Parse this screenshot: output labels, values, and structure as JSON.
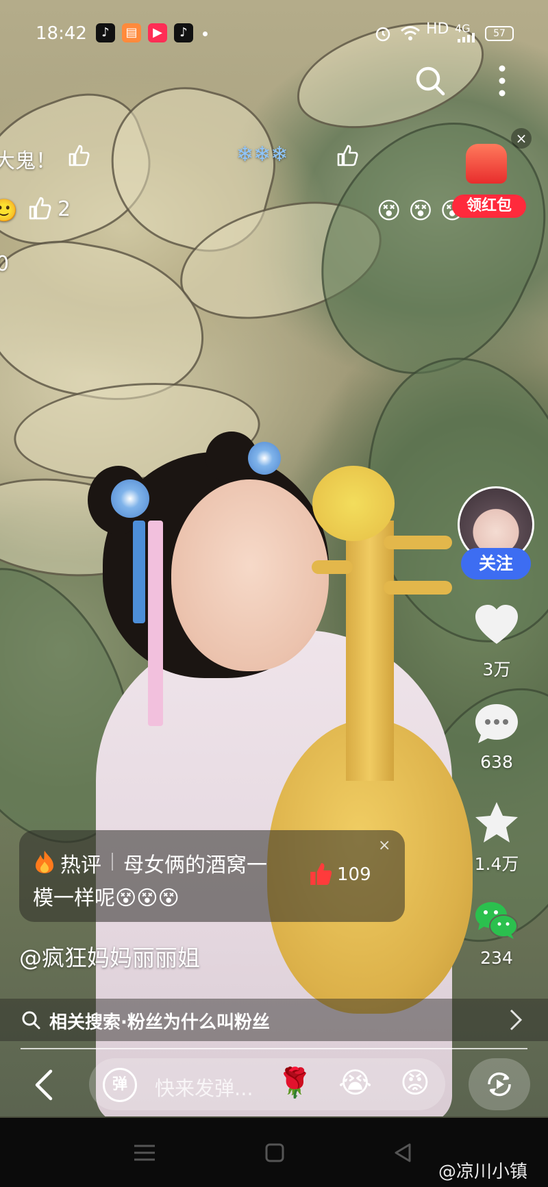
{
  "status_bar": {
    "time": "18:42",
    "network": "HD",
    "signal": "4G",
    "battery": "57",
    "app_icons": [
      "tiktok-icon",
      "reader-app-icon",
      "video-app-icon",
      "tiktok-lite-icon"
    ]
  },
  "danmaku": [
    {
      "text": "大鬼！"
    },
    {
      "text": "❄❄❄"
    },
    {
      "text": "2"
    },
    {
      "text": "0"
    }
  ],
  "emoji_reactions": [
    "😵",
    "😵",
    "😵"
  ],
  "red_packet": {
    "label": "领红包"
  },
  "right_rail": {
    "follow_label": "关注",
    "likes": "3万",
    "comments": "638",
    "favorites": "1.4万",
    "shares": "234"
  },
  "hot_comment": {
    "title": "热评",
    "line1": "母女俩的酒窝一",
    "line2": "模一样呢😵😵😵",
    "likes": "109",
    "close": "×"
  },
  "author": {
    "name": "@疯狂妈妈丽丽姐"
  },
  "related_search": {
    "text": "相关搜索·粉丝为什么叫粉丝"
  },
  "danmaku_input": {
    "badge": "弹",
    "placeholder": "快来发弹...",
    "emojis": [
      "🌹",
      "😭",
      "😡"
    ]
  },
  "watermark": "@凉川小镇",
  "colors": {
    "follow_blue": "#3d6df2",
    "red_packet": "#ff2a3c",
    "like_red": "#ff3b3b"
  }
}
